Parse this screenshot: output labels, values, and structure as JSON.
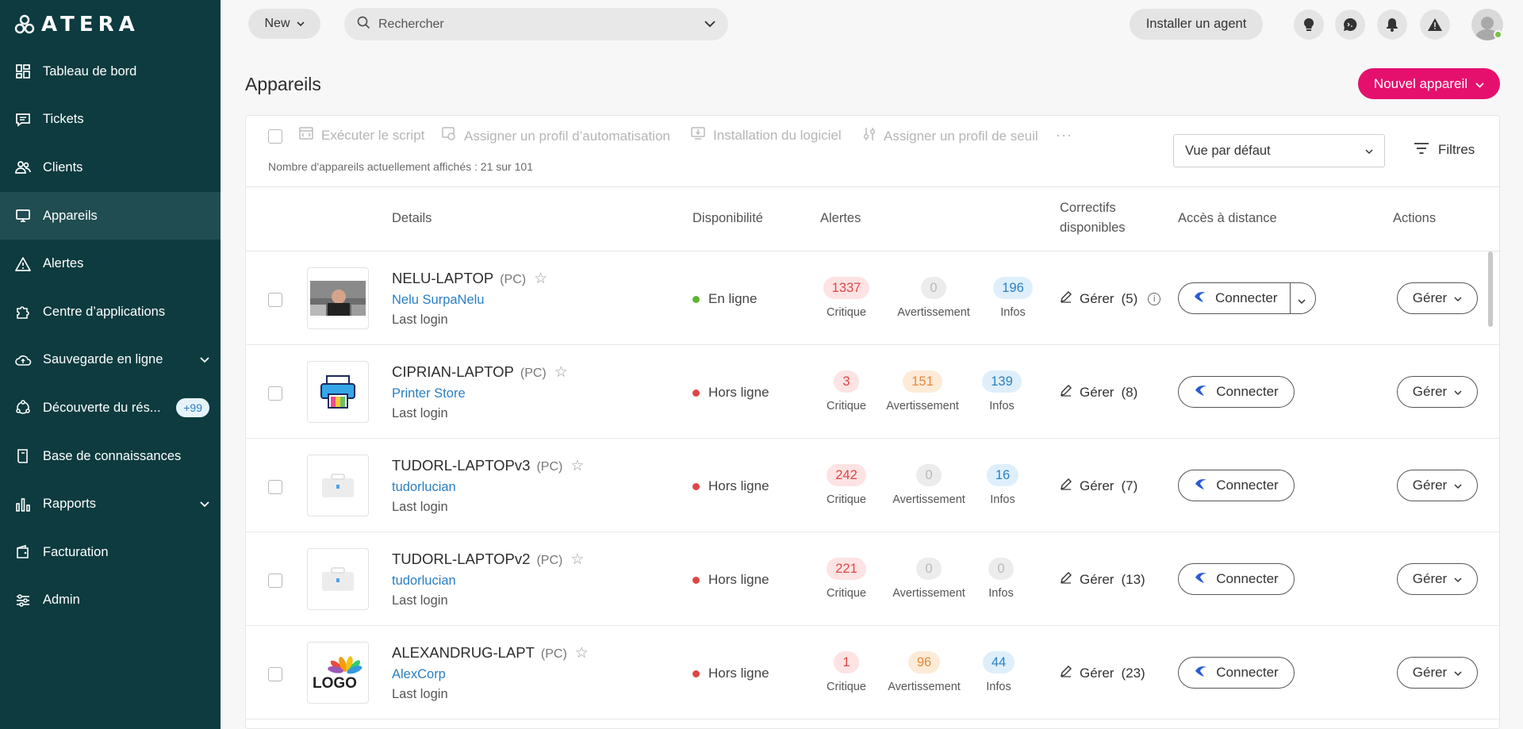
{
  "brand": {
    "logo_text": "ATERA",
    "accent": "#e5106e",
    "sidebar_bg": "#0d3b3f"
  },
  "sidebar": {
    "items": [
      {
        "label": "Tableau de bord",
        "icon": "dashboard-icon"
      },
      {
        "label": "Tickets",
        "icon": "ticket-icon"
      },
      {
        "label": "Clients",
        "icon": "users-icon"
      },
      {
        "label": "Appareils",
        "icon": "monitor-icon",
        "active": true
      },
      {
        "label": "Alertes",
        "icon": "warning-icon"
      },
      {
        "label": "Centre d’applications",
        "icon": "puzzle-icon"
      },
      {
        "label": "Sauvegarde en ligne",
        "icon": "cloud-icon",
        "chevron": true
      },
      {
        "label": "Découverte du rés...",
        "icon": "network-icon",
        "badge": "+99"
      },
      {
        "label": "Base de connaissances",
        "icon": "book-icon"
      },
      {
        "label": "Rapports",
        "icon": "chart-icon",
        "chevron": true
      },
      {
        "label": "Facturation",
        "icon": "wallet-icon"
      },
      {
        "label": "Admin",
        "icon": "sliders-icon"
      }
    ]
  },
  "topbar": {
    "new_label": "New",
    "search_placeholder": "Rechercher",
    "install_agent_label": "Installer un agent"
  },
  "page": {
    "title": "Appareils",
    "new_device_label": "Nouvel appareil"
  },
  "toolbar": {
    "run_script": "Exécuter le script",
    "assign_automation": "Assigner un profil d’automatisation",
    "install_software": "Installation du logiciel",
    "assign_threshold": "Assigner un profil de seuil",
    "more": "···",
    "count_text": "Nombre d'appareils actuellement affichés : 21 sur 101",
    "view_select": "Vue par défaut",
    "filters_label": "Filtres"
  },
  "table": {
    "headers": {
      "details": "Details",
      "availability": "Disponibilité",
      "alerts": "Alertes",
      "patches_line1": "Correctifs",
      "patches_line2": "disponibles",
      "remote": "Accès à distance",
      "actions": "Actions"
    },
    "labels": {
      "critical": "Critique",
      "warning": "Avertissement",
      "info": "Infos",
      "manage": "Gérer",
      "connect": "Connecter",
      "last_login": "Last login",
      "type": "(PC)"
    },
    "rows": [
      {
        "name": "NELU-LAPTOP",
        "client": "Nelu SurpaNelu",
        "status": "En ligne",
        "status_color": "#5cb531",
        "critical": "1337",
        "warning": "0",
        "info": "196",
        "patches": "(5)",
        "thumb": "photo"
      },
      {
        "name": "CIPRIAN-LAPTOP",
        "client": "Printer Store",
        "status": "Hors ligne",
        "status_color": "#e04545",
        "critical": "3",
        "warning": "151",
        "info": "139",
        "patches": "(8)",
        "thumb": "printer"
      },
      {
        "name": "TUDORL-LAPTOPv3",
        "client": "tudorlucian",
        "status": "Hors ligne",
        "status_color": "#e04545",
        "critical": "242",
        "warning": "0",
        "info": "16",
        "patches": "(7)",
        "thumb": "placeholder"
      },
      {
        "name": "TUDORL-LAPTOPv2",
        "client": "tudorlucian",
        "status": "Hors ligne",
        "status_color": "#e04545",
        "critical": "221",
        "warning": "0",
        "info": "0",
        "patches": "(13)",
        "thumb": "placeholder"
      },
      {
        "name": "ALEXANDRUG-LAPT",
        "client": "AlexCorp",
        "status": "Hors ligne",
        "status_color": "#e04545",
        "critical": "1",
        "warning": "96",
        "info": "44",
        "patches": "(23)",
        "thumb": "logo",
        "logo_text": "LOGO"
      }
    ]
  }
}
